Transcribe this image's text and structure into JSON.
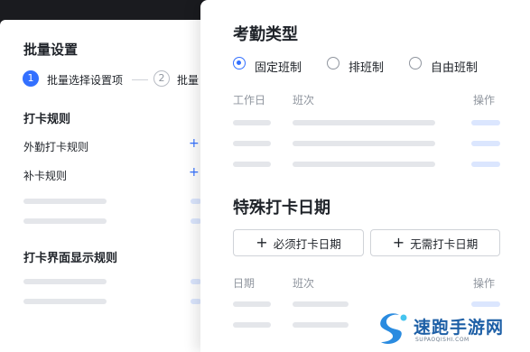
{
  "batch_panel": {
    "title": "批量设置",
    "steps": [
      {
        "num": "1",
        "label": "批量选择设置项"
      },
      {
        "num": "2",
        "label": "批量"
      }
    ],
    "punch_rules": {
      "title": "打卡规则",
      "items": [
        "外勤打卡规则",
        "补卡规则"
      ]
    },
    "display_rules": {
      "title": "打卡界面显示规则"
    }
  },
  "attendance_type": {
    "title": "考勤类型",
    "options": [
      {
        "label": "固定班制",
        "selected": true
      },
      {
        "label": "排班制",
        "selected": false
      },
      {
        "label": "自由班制",
        "selected": false
      }
    ],
    "table_headers": {
      "workday": "工作日",
      "shift": "班次",
      "action": "操作"
    }
  },
  "special_dates": {
    "title": "特殊打卡日期",
    "buttons": {
      "required": "必须打卡日期",
      "not_required": "无需打卡日期"
    },
    "table_headers": {
      "date": "日期",
      "shift": "班次",
      "action": "操作"
    }
  },
  "watermark": {
    "text": "速跑手游网",
    "sub": "SUPAOQISHI.COM"
  },
  "colors": {
    "accent": "#3370ff",
    "background": "#1a1b1f"
  }
}
